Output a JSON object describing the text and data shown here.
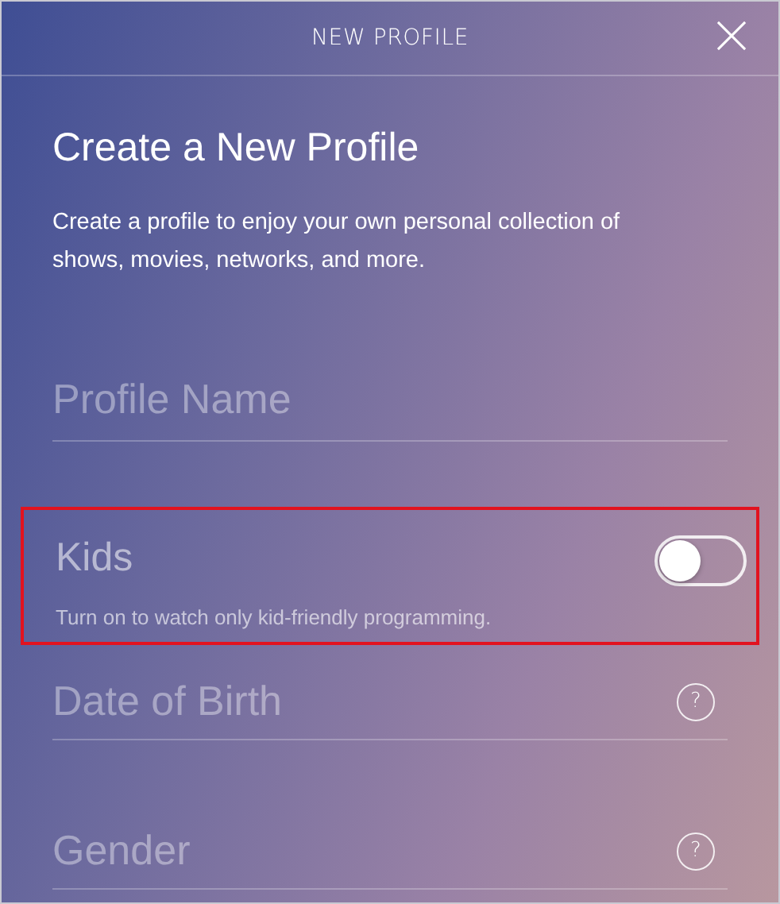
{
  "header": {
    "title": "NEW PROFILE"
  },
  "heading": "Create a New Profile",
  "description": "Create a profile to enjoy your own personal collection of shows, movies, networks, and more.",
  "fields": [
    {
      "kind": "text",
      "placeholder": "Profile Name"
    },
    {
      "kind": "toggle",
      "label": "Kids",
      "hint": "Turn on to watch only kid-friendly programming.",
      "on": false,
      "highlighted": true
    },
    {
      "kind": "help",
      "label": "Date of Birth",
      "help": "?"
    },
    {
      "kind": "help",
      "label": "Gender",
      "help": "?"
    }
  ]
}
